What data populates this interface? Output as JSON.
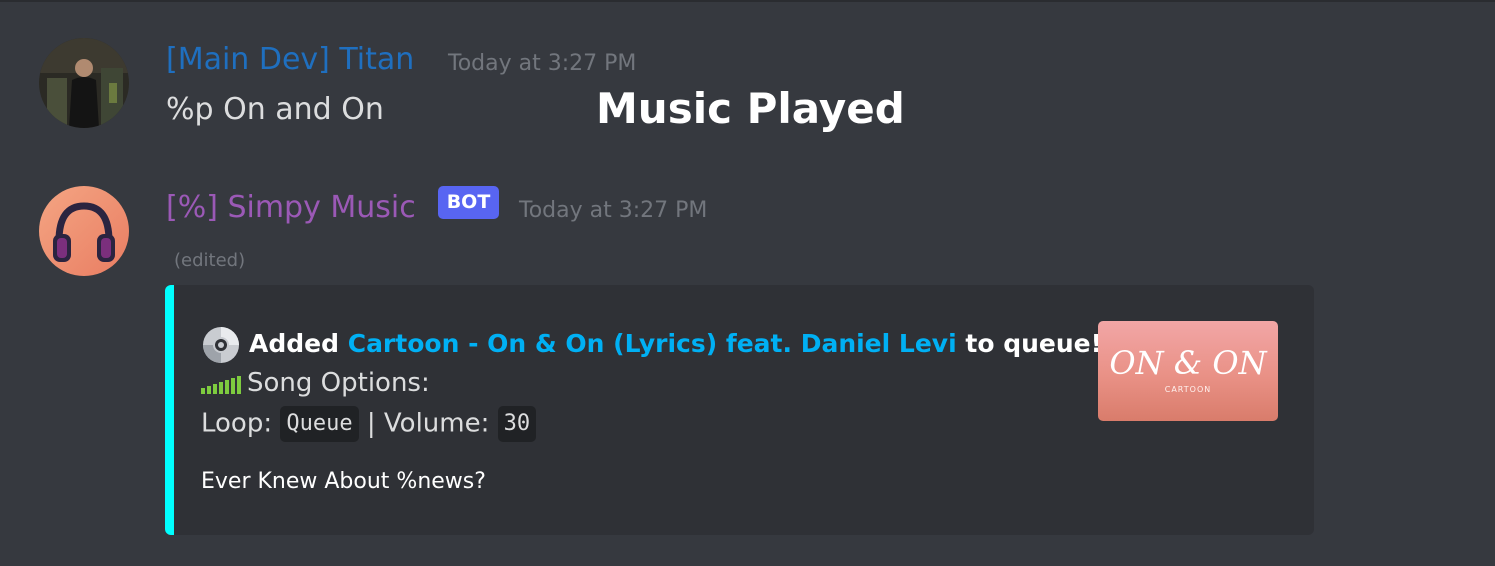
{
  "overlay": {
    "title": "Music Played"
  },
  "messages": [
    {
      "username": "[Main Dev] Titan",
      "timestamp": "Today at 3:27 PM",
      "content": "%p On and On",
      "avatar": "user-avatar"
    },
    {
      "username": "[%] Simpy Music",
      "badge": "BOT",
      "timestamp": "Today at 3:27 PM",
      "edited": "(edited)",
      "avatar": "headphones-avatar",
      "embed": {
        "accent_color": "#00ffff",
        "added_prefix": "Added",
        "song_title": "Cartoon - On & On (Lyrics) feat. Daniel Levi",
        "added_suffix": "to queue!",
        "options_label": "Song Options:",
        "loop_label": "Loop:",
        "loop_value": "Queue",
        "separator": "|",
        "volume_label": "Volume:",
        "volume_value": "30",
        "footer": "Ever Knew About %news?",
        "thumbnail": {
          "title": "ON & ON",
          "subtitle": "CARTOON"
        },
        "icons": [
          "cd-icon",
          "equalizer-icon"
        ]
      }
    }
  ],
  "colors": {
    "background": "#36393f",
    "embed_background": "#2f3136",
    "username_1": "#1f6fbf",
    "username_2": "#9b59b6",
    "link": "#00b0f4",
    "bot_badge": "#5865f2"
  }
}
